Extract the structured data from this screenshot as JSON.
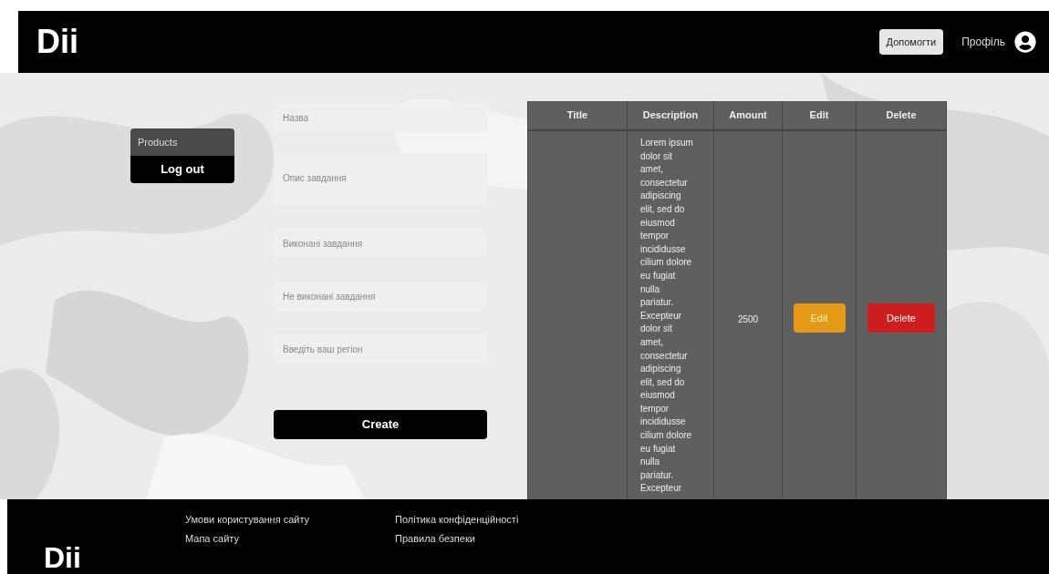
{
  "header": {
    "logo": "Dii",
    "help_button": "Допомогти",
    "profile_link": "Профіль"
  },
  "sidebar": {
    "items": [
      {
        "label": "Products",
        "selected": true
      },
      {
        "label": "Log out",
        "selected": false
      }
    ]
  },
  "form": {
    "fields": [
      {
        "kind": "input",
        "placeholder": "Назва"
      },
      {
        "kind": "textarea",
        "placeholder": "Опис завдання"
      },
      {
        "kind": "input",
        "placeholder": "Виконані завдання"
      },
      {
        "kind": "input",
        "placeholder": "Не виконані завдання"
      },
      {
        "kind": "input",
        "placeholder": "Введіть ваш регіон"
      }
    ],
    "submit": "Create"
  },
  "table": {
    "columns": [
      "Title",
      "Description",
      "Amount",
      "Edit",
      "Delete"
    ],
    "rows": [
      {
        "title": "",
        "description": "Lorem ipsum dolor sit amet, consectetur adipiscing elit, sed do eiusmod tempor incididusse cilium dolore eu fugiat nulla pariatur. Excepteur dolor sit amet, consectetur adipiscing elit, sed do eiusmod tempor incididusse cilium dolore eu fugiat nulla pariatur. Excepteur",
        "amount": "2500",
        "edit": "Edit",
        "delete": "Delete"
      }
    ]
  },
  "footer": {
    "logo": "Dii",
    "links": [
      [
        "Умови користування сайту",
        "Мапа сайту"
      ],
      [
        "Політика конфіденційності",
        "Правила безпеки"
      ]
    ]
  }
}
